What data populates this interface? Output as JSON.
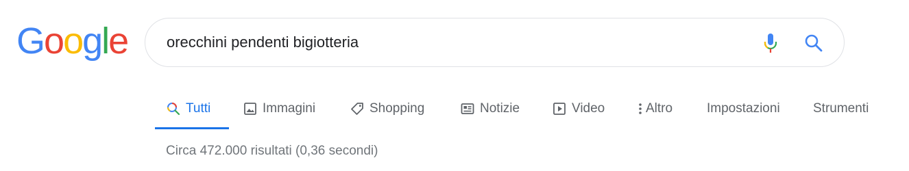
{
  "logo": {
    "letters": [
      "G",
      "o",
      "o",
      "g",
      "l",
      "e"
    ],
    "colors": [
      "#4285F4",
      "#EA4335",
      "#FBBC05",
      "#4285F4",
      "#34A853",
      "#EA4335"
    ]
  },
  "search": {
    "query": "orecchini pendenti bigiotteria"
  },
  "tabs": [
    {
      "label": "Tutti",
      "icon": "search-icon",
      "active": true
    },
    {
      "label": "Immagini",
      "icon": "image-icon"
    },
    {
      "label": "Shopping",
      "icon": "tag-icon"
    },
    {
      "label": "Notizie",
      "icon": "newspaper-icon"
    },
    {
      "label": "Video",
      "icon": "play-icon"
    },
    {
      "label": "Altro",
      "icon": "more-vert-icon"
    },
    {
      "label": "Impostazioni"
    },
    {
      "label": "Strumenti"
    }
  ],
  "results": {
    "stats": "Circa 472.000 risultati (0,36 secondi)"
  },
  "colors": {
    "accent": "#1a73e8",
    "tab_text": "#5f6368",
    "stats_text": "#70757a",
    "border": "#dfe1e5"
  }
}
